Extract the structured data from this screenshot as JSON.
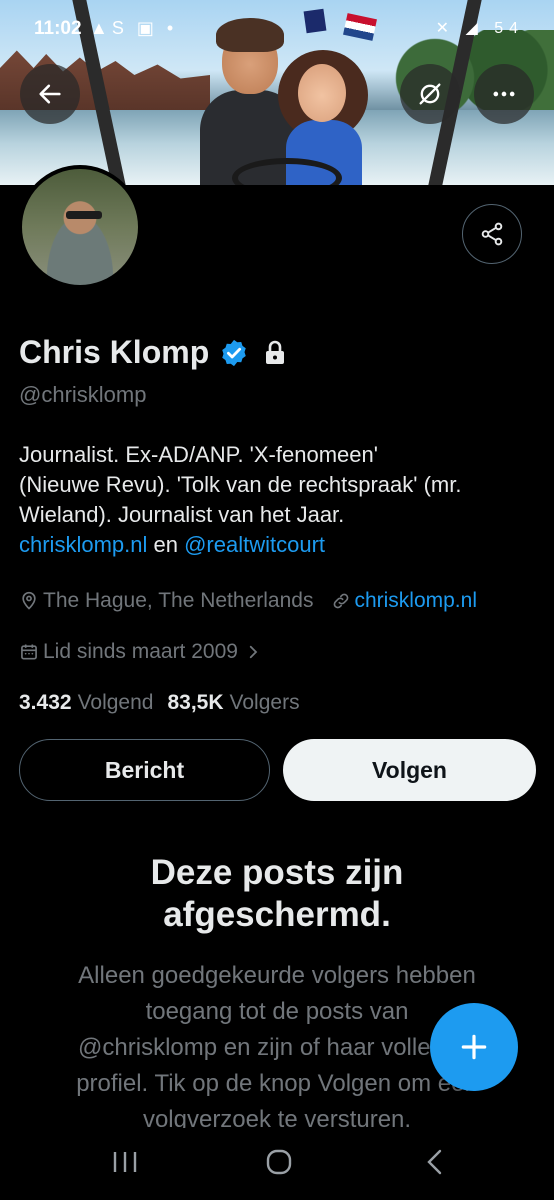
{
  "status_bar": {
    "time": "11:02",
    "left_icons": "▲S ▣ •",
    "right_icons": "✕ ◢ 54"
  },
  "profile": {
    "name": "Chris Klomp",
    "handle": "@chrisklomp",
    "bio_lines": [
      "Journalist. Ex-AD/ANP.  'X-fenomeen'",
      "(Nieuwe Revu). 'Tolk van de rechtspraak' (mr.",
      "Wieland). Journalist van het Jaar."
    ],
    "bio_link1": "chrisklomp.nl",
    "bio_and": " en ",
    "bio_link2": "@realtwitcourt",
    "location": "The Hague, The Netherlands",
    "website": "chrisklomp.nl",
    "joined": "Lid sinds maart 2009",
    "following_count": "3.432",
    "following_label": "Volgend",
    "followers_count": "83,5K",
    "followers_label": "Volgers"
  },
  "buttons": {
    "message": "Bericht",
    "follow": "Volgen"
  },
  "protected": {
    "title_line1": "Deze posts zijn",
    "title_line2": "afgeschermd.",
    "body_lines": [
      "Alleen goedgekeurde volgers hebben",
      "toegang tot de posts van",
      "@chrisklomp en zijn of haar volledige",
      "profiel. Tik op de knop Volgen om een",
      "volgverzoek te versturen."
    ]
  },
  "colors": {
    "accent": "#1d9bf0",
    "background": "#000000",
    "text_primary": "#e7e9ea",
    "text_secondary": "#71767b"
  },
  "icons": {
    "back": "arrow-left-icon",
    "unfollow_notify": "bell-off-icon",
    "more": "ellipsis-icon",
    "share": "share-icon",
    "verified": "verified-badge-icon",
    "protected": "lock-icon",
    "location": "location-pin-icon",
    "website": "link-icon",
    "joined": "calendar-icon",
    "compose": "plus-icon"
  }
}
